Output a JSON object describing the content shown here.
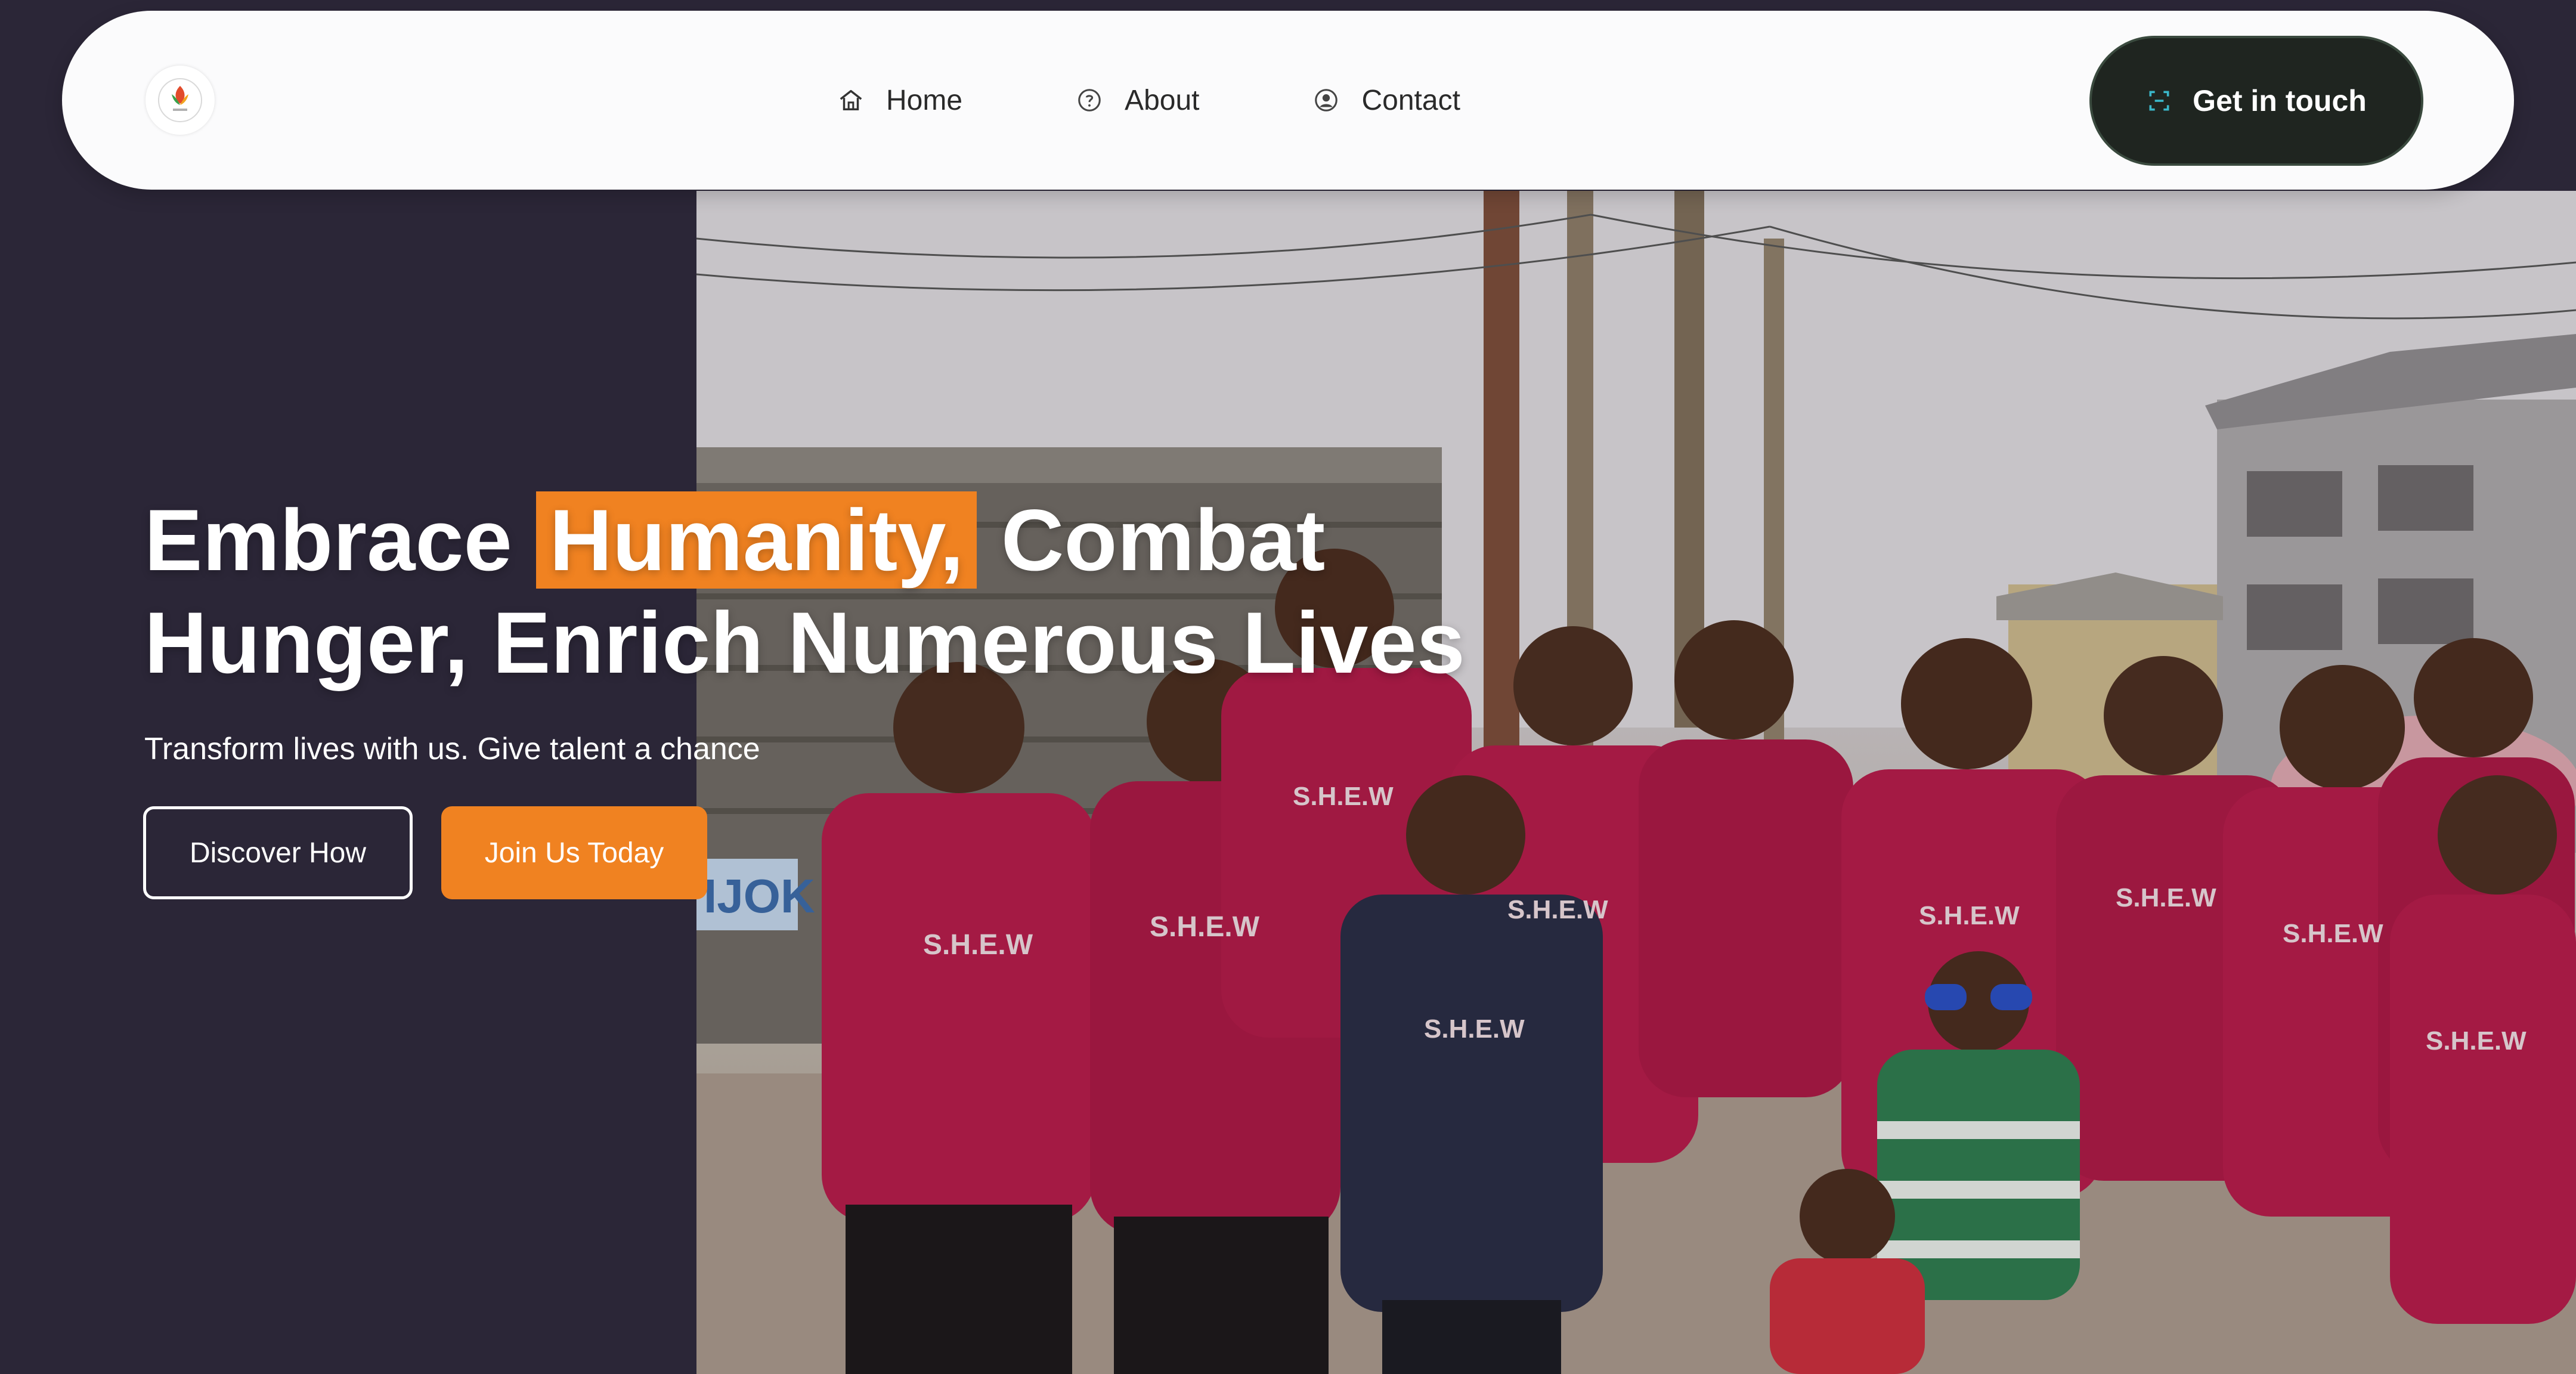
{
  "colors": {
    "page_background": "#2b2637",
    "accent": "#f08221",
    "cta_background": "#1f2520",
    "navbar_background": "#fbfbfc"
  },
  "navbar": {
    "logo_icon": "organization-logo-icon",
    "links": [
      {
        "label": "Home",
        "icon": "home-icon"
      },
      {
        "label": "About",
        "icon": "question-circle-icon"
      },
      {
        "label": "Contact",
        "icon": "user-circle-icon"
      }
    ],
    "cta": {
      "label": "Get in touch",
      "icon": "scan-icon"
    }
  },
  "hero": {
    "title_part1": "Embrace ",
    "title_highlight": "Humanity,",
    "title_part2": " Combat",
    "title_line2": "Hunger, Enrich Numerous Lives",
    "subtitle": "Transform lives with us. Give talent a chance",
    "primary_button": "Discover How",
    "secondary_button": "Join Us Today",
    "photo_description_icon": "group-photo-image",
    "shirt_text": "S.H.E.W",
    "sign_text": "IJOK"
  }
}
